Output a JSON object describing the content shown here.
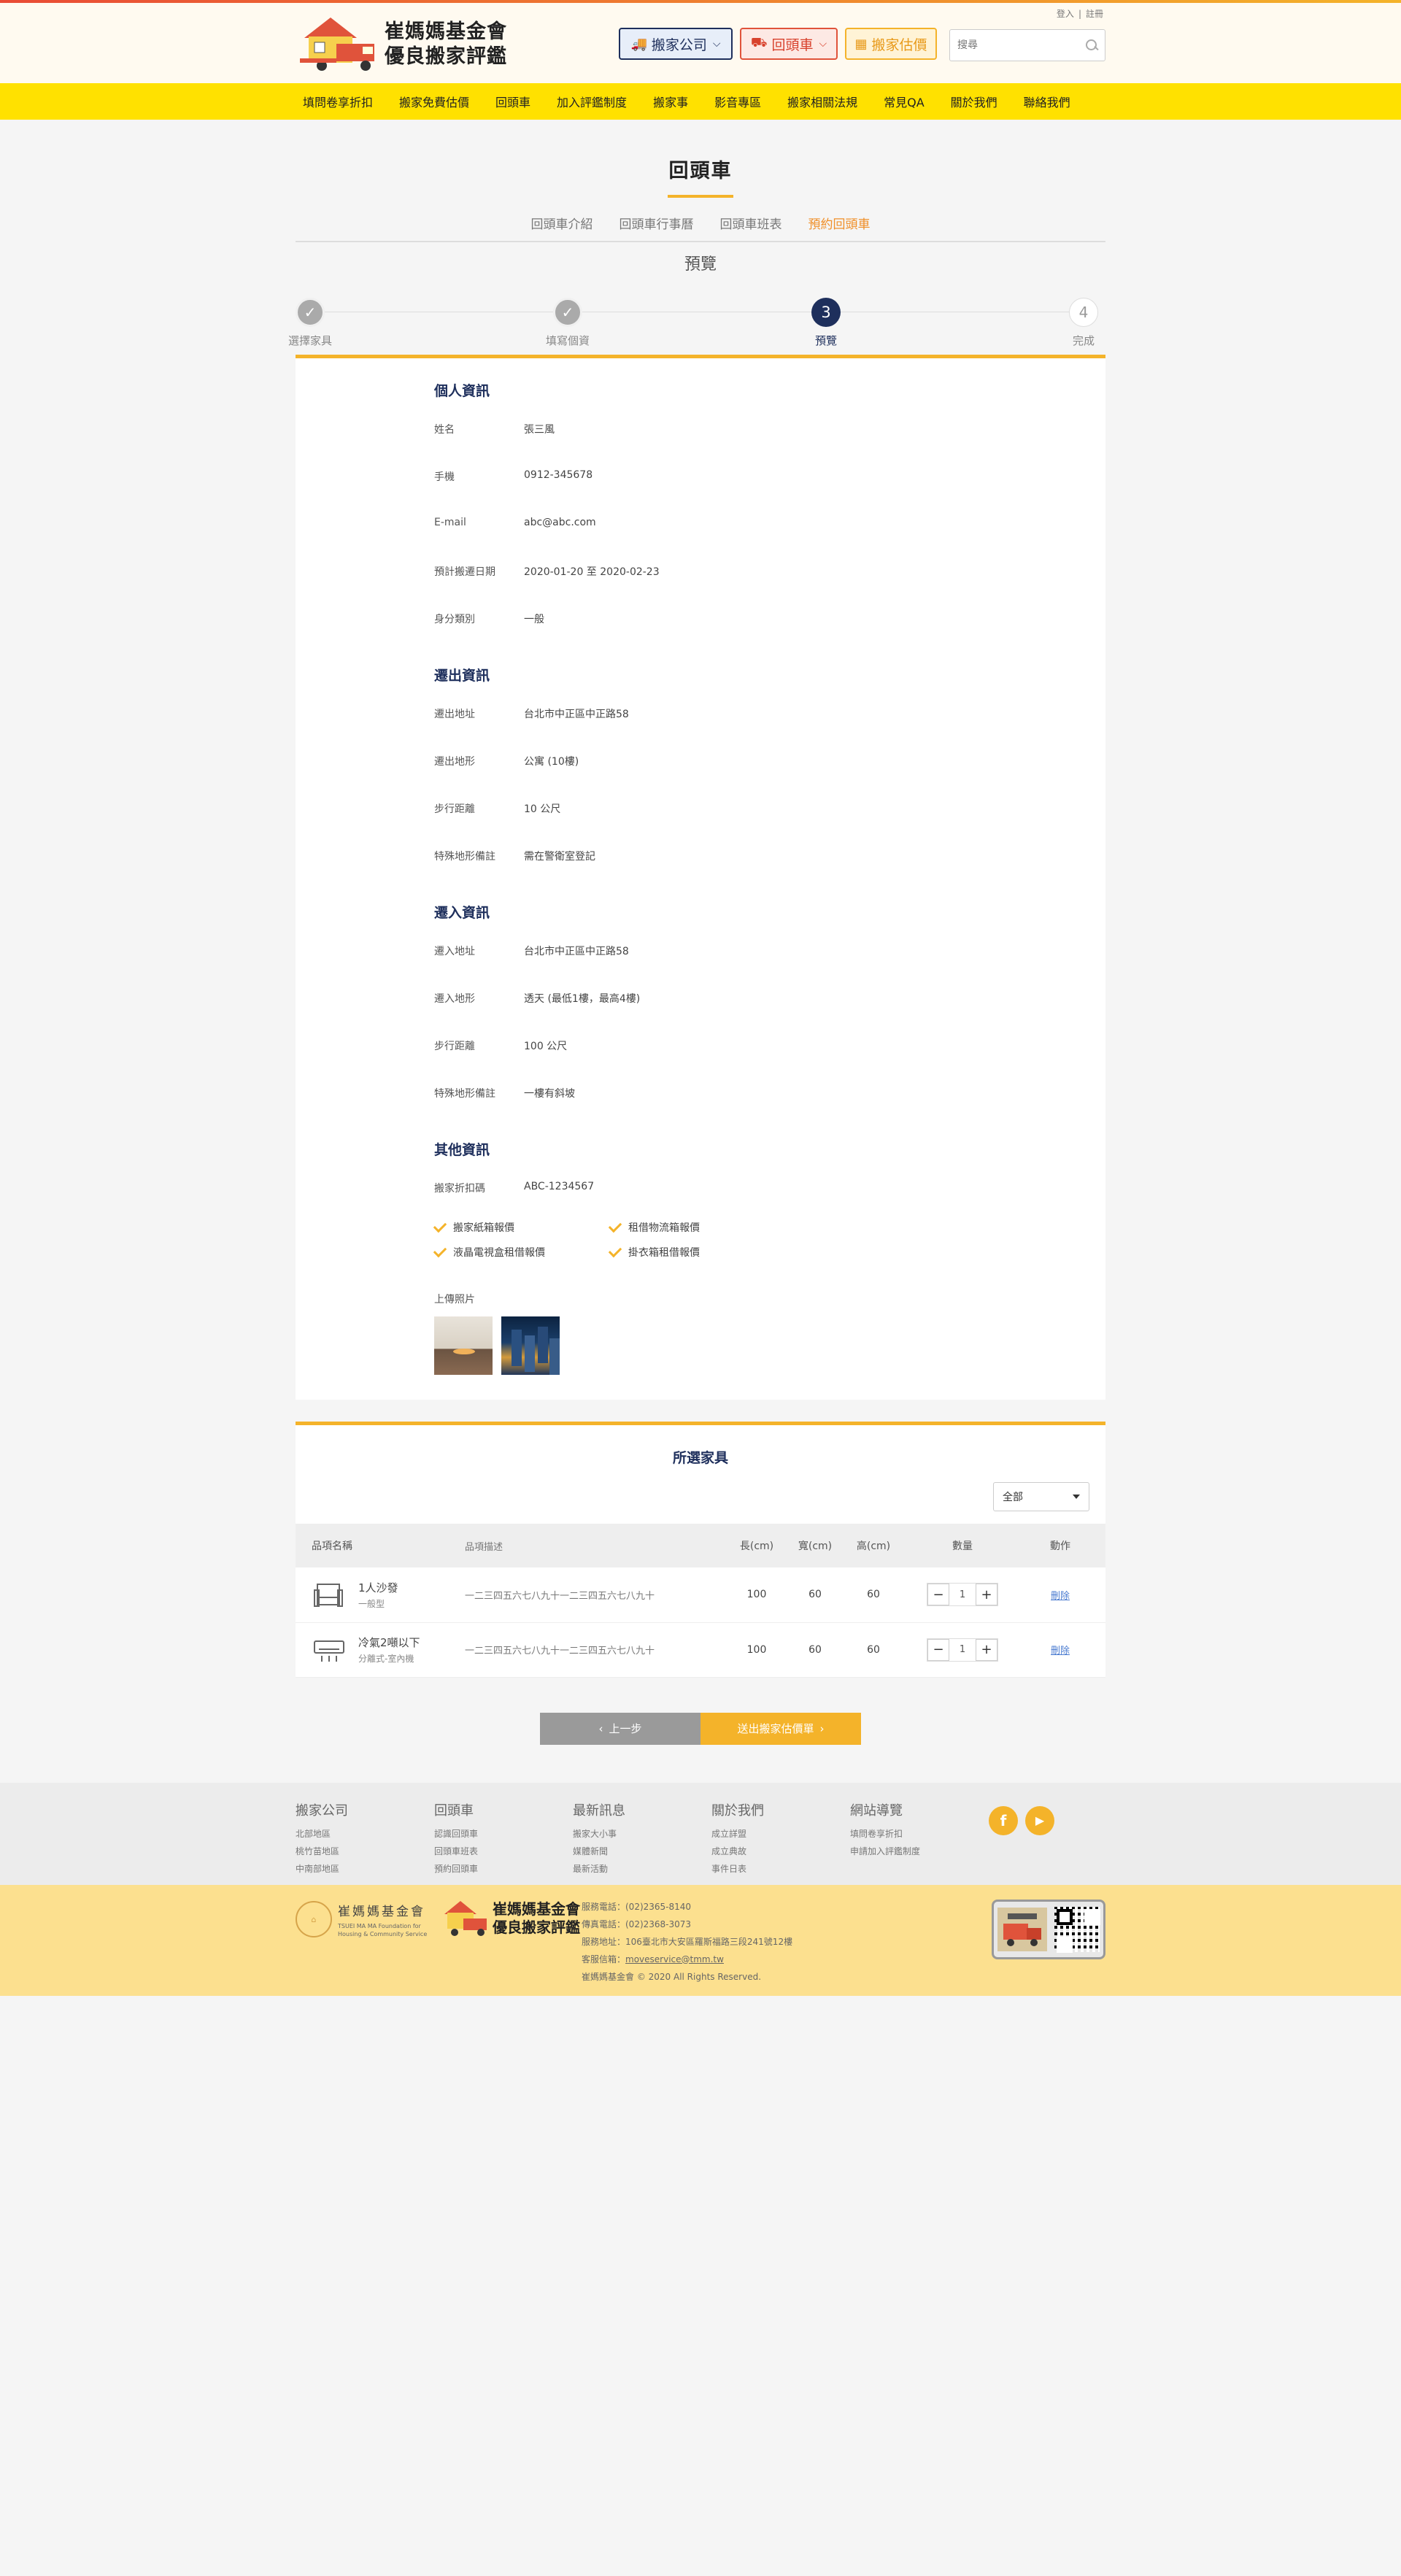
{
  "header": {
    "brand_line1": "崔媽媽基金會",
    "brand_line2": "優良搬家評鑑",
    "login": "登入",
    "register": "註冊",
    "separator": "|",
    "buttons": {
      "moving_company": "搬家公司",
      "return_truck": "回頭車",
      "estimate": "搬家估價"
    },
    "search_placeholder": "搜尋"
  },
  "nav": [
    "填問卷享折扣",
    "搬家免費估價",
    "回頭車",
    "加入評鑑制度",
    "搬家事",
    "影音專區",
    "搬家相關法規",
    "常見QA",
    "關於我們",
    "聯絡我們"
  ],
  "page": {
    "title": "回頭車",
    "subtabs": [
      "回頭車介紹",
      "回頭車行事曆",
      "回頭車班表",
      "預約回頭車"
    ],
    "active_subtab": "預約回頭車",
    "step_heading": "預覽"
  },
  "steps": [
    {
      "num": "1",
      "label": "選擇家具",
      "state": "done"
    },
    {
      "num": "2",
      "label": "填寫個資",
      "state": "done"
    },
    {
      "num": "3",
      "label": "預覽",
      "state": "current"
    },
    {
      "num": "4",
      "label": "完成",
      "state": "todo"
    }
  ],
  "personal": {
    "title": "個人資訊",
    "rows": [
      {
        "k": "姓名",
        "v": "張三風"
      },
      {
        "k": "手機",
        "v": "0912-345678"
      },
      {
        "k": "E-mail",
        "v": "abc@abc.com"
      },
      {
        "k": "預計搬遷日期",
        "v": "2020-01-20 至 2020-02-23"
      },
      {
        "k": "身分類別",
        "v": "一般"
      }
    ]
  },
  "moveout": {
    "title": "遷出資訊",
    "rows": [
      {
        "k": "遷出地址",
        "v": "台北市中正區中正路58"
      },
      {
        "k": "遷出地形",
        "v": "公寓 (10樓)"
      },
      {
        "k": "步行距離",
        "v": "10 公尺"
      },
      {
        "k": "特殊地形備註",
        "v": "需在警衛室登記"
      }
    ]
  },
  "movein": {
    "title": "遷入資訊",
    "rows": [
      {
        "k": "遷入地址",
        "v": "台北市中正區中正路58"
      },
      {
        "k": "遷入地形",
        "v": "透天 (最低1樓，最高4樓)"
      },
      {
        "k": "步行距離",
        "v": "100 公尺"
      },
      {
        "k": "特殊地形備註",
        "v": "一樓有斜坡"
      }
    ]
  },
  "other": {
    "title": "其他資訊",
    "rows": [
      {
        "k": "搬家折扣碼",
        "v": "ABC-1234567"
      }
    ],
    "checks": [
      "搬家紙箱報價",
      "租借物流箱報價",
      "液晶電視盒租借報價",
      "掛衣箱租借報價"
    ],
    "upload_label": "上傳照片"
  },
  "furniture": {
    "title": "所選家具",
    "filter": "全部",
    "headers": {
      "name": "品項名稱",
      "desc": "品項描述",
      "len": "長(cm)",
      "wid": "寬(cm)",
      "hei": "高(cm)",
      "qty": "數量",
      "act": "動作"
    },
    "rows": [
      {
        "name": "1人沙發",
        "type": "一般型",
        "desc": "一二三四五六七八九十一二三四五六七八九十",
        "len": "100",
        "wid": "60",
        "hei": "60",
        "qty": "1",
        "action": "刪除",
        "icon": "sofa-icon"
      },
      {
        "name": "冷氣2噸以下",
        "type": "分離式-室內機",
        "desc": "一二三四五六七八九十一二三四五六七八九十",
        "len": "100",
        "wid": "60",
        "hei": "60",
        "qty": "1",
        "action": "刪除",
        "icon": "air-conditioner-icon"
      }
    ]
  },
  "actions": {
    "prev": "上一步",
    "next": "送出搬家估價單"
  },
  "footer": {
    "cols": [
      {
        "title": "搬家公司",
        "items": [
          "北部地區",
          "桃竹苗地區",
          "中南部地區"
        ]
      },
      {
        "title": "回頭車",
        "items": [
          "認識回頭車",
          "回頭車班表",
          "預約回頭車"
        ]
      },
      {
        "title": "最新訊息",
        "items": [
          "搬家大小事",
          "媒體新聞",
          "最新活動"
        ]
      },
      {
        "title": "關於我們",
        "items": [
          "成立詳盟",
          "成立典故",
          "事件日表"
        ]
      },
      {
        "title": "網站導覽",
        "items": [
          "填問卷享折扣",
          "申請加入評鑑制度"
        ]
      }
    ],
    "social": {
      "facebook": "f",
      "youtube": "▶"
    },
    "foundation_name": "崔媽媽基金會",
    "foundation_en": "TSUEI MA MA Foundation for Housing & Community Service",
    "brand_line1": "崔媽媽基金會",
    "brand_line2": "優良搬家評鑑",
    "info": {
      "phone": "服務電話：(02)2365-8140",
      "fax": "傳真電話：(02)2368-3073",
      "address": "服務地址：106臺北市大安區羅斯福路三段241號12樓",
      "email_label": "客服信箱：",
      "email": "moveservice@tmm.tw",
      "copyright": "崔媽媽基金會 © 2020 All Rights Reserved."
    }
  },
  "colors": {
    "accent": "#f4b32a",
    "navy": "#1e2f5c",
    "nav_bg": "#ffe100",
    "red": "#e0533b"
  }
}
